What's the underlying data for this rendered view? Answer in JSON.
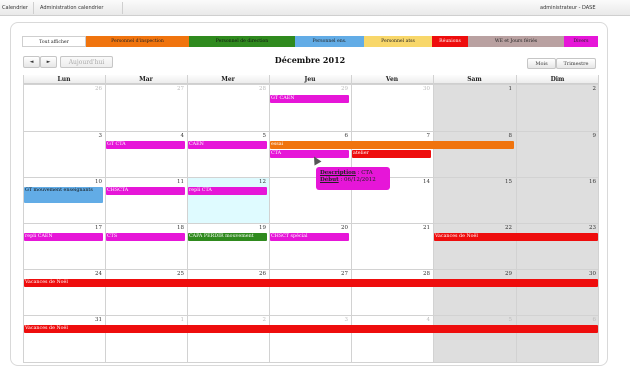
{
  "topbar": {
    "items": [
      "Calendrier",
      "Administration calendrier"
    ],
    "user": "administrateur - DASE"
  },
  "legend": [
    {
      "label": "Tout afficher",
      "color": "#ffffff"
    },
    {
      "label": "Personnel d'inspection",
      "color": "#f0740e"
    },
    {
      "label": "Personnel de direction",
      "color": "#2f8a1e"
    },
    {
      "label": "Personnel ens.",
      "color": "#62ace6"
    },
    {
      "label": "Personnel atss",
      "color": "#f8d76a"
    },
    {
      "label": "Réunions",
      "color": "#ee0d0d"
    },
    {
      "label": "WE et Jours fériés",
      "color": "#b9a1a1"
    },
    {
      "label": "Divers",
      "color": "#e616d8"
    }
  ],
  "toolbar": {
    "prev_icon": "◄",
    "next_icon": "►",
    "today_label": "Aujourd'hui",
    "month_label": "Mois",
    "quarter_label": "Trimestre"
  },
  "calendar": {
    "title": "Décembre 2012",
    "weekdays": [
      "Lun",
      "Mar",
      "Mer",
      "Jeu",
      "Ven",
      "Sam",
      "Dim"
    ],
    "weeks": [
      [
        26,
        27,
        28,
        29,
        30,
        1,
        2
      ],
      [
        3,
        4,
        5,
        6,
        7,
        8,
        9
      ],
      [
        10,
        11,
        12,
        13,
        14,
        15,
        16
      ],
      [
        17,
        18,
        19,
        20,
        21,
        22,
        23
      ],
      [
        24,
        25,
        26,
        27,
        28,
        29,
        30
      ],
      [
        31,
        1,
        2,
        3,
        4,
        5,
        6
      ]
    ]
  },
  "events": {
    "gt_caen": "GT CAEN",
    "gt_cta": "GT CTA",
    "caen": "CAEN",
    "essai": "essai",
    "cta": "CTA",
    "atelier": "atelier",
    "gt_mouvement": "GT mouvement enseignants",
    "chscta": "CHSCTA",
    "repli_cta": "repli CTA",
    "repli_caen": "repli CAEN",
    "cts": "CTS",
    "capa": "CAPA PERDIR mouvement",
    "chsct": "CHSCT spécial",
    "vacances": "Vacances de Noël"
  },
  "tooltip": {
    "desc_label": "Description",
    "desc_value": " : CTA",
    "start_label": "Début",
    "start_value": " : 06/12/2012"
  }
}
